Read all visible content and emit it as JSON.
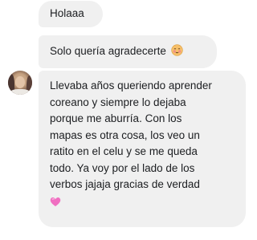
{
  "messages": [
    {
      "text": "Holaaa"
    },
    {
      "text": "Solo quería agradecerte",
      "emoji": "blushing-face-icon"
    },
    {
      "lines": [
        "Llevaba años queriendo aprender",
        "coreano y siempre lo dejaba",
        "porque me aburría. Con los",
        "mapas es otra cosa, los veo un",
        "ratito en el celu y se me queda",
        "todo. Ya voy por el lado de los",
        "verbos jajaja gracias de verdad"
      ],
      "emoji": "pink-heart-icon"
    }
  ],
  "colors": {
    "bubble": "#f0f0f0",
    "text": "#1c1e21",
    "heart": "#f06fc1"
  }
}
